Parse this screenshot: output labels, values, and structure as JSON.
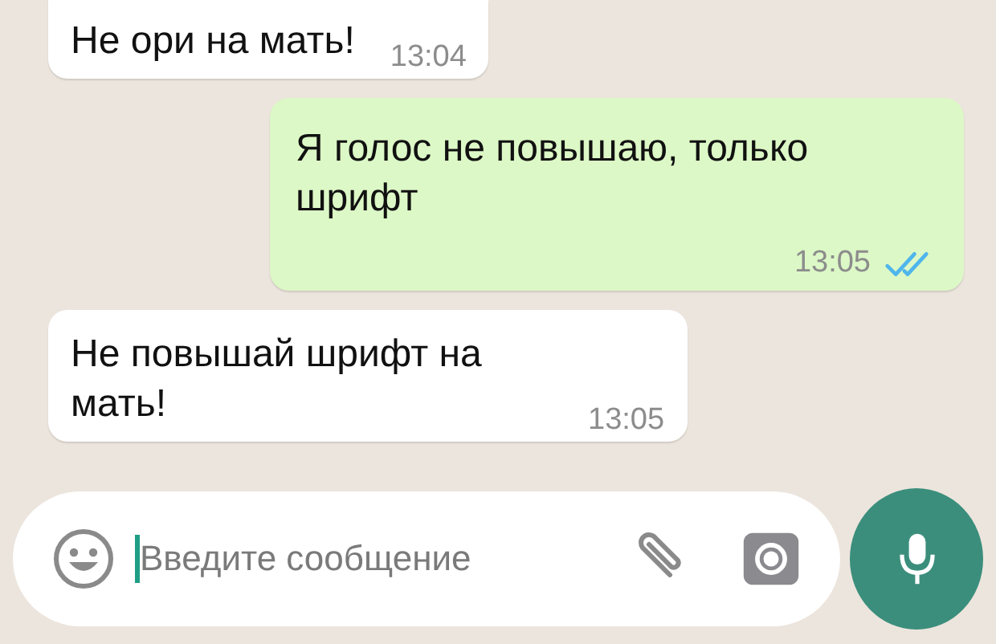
{
  "messages": [
    {
      "kind": "incoming",
      "text": "Не ори на мать!",
      "time": "13:04"
    },
    {
      "kind": "outgoing",
      "text": "Я голос не повышаю, только шрифт",
      "time": "13:05",
      "read": true
    },
    {
      "kind": "incoming",
      "text": "Не повышай шрифт на мать!",
      "time": "13:05"
    }
  ],
  "composer": {
    "placeholder": "Введите сообщение"
  }
}
